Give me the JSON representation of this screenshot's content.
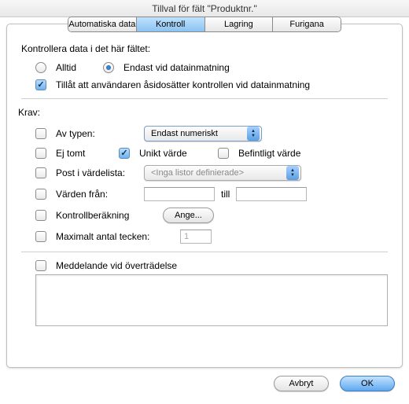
{
  "title": "Tillval för fält \"Produktnr.\"",
  "tabs": {
    "auto": "Automatiska data",
    "kontroll": "Kontroll",
    "lagring": "Lagring",
    "furigana": "Furigana"
  },
  "kontroll": {
    "section_label": "Kontrollera data i det här fältet:",
    "radio_always": "Alltid",
    "radio_dataentry": "Endast vid datainmatning",
    "override": "Tillåt att användaren åsidosätter kontrollen vid datainmatning"
  },
  "krav": {
    "header": "Krav:",
    "type": "Av typen:",
    "type_select": "Endast numeriskt",
    "not_empty": "Ej tomt",
    "unique": "Unikt värde",
    "existing": "Befintligt värde",
    "valuelist": "Post i värdelista:",
    "valuelist_select": "<Inga listor definierade>",
    "range_from": "Värden från:",
    "range_to": "till",
    "calc": "Kontrollberäkning",
    "calc_btn": "Ange...",
    "maxlen": "Maximalt antal tecken:",
    "maxlen_value": "1",
    "message": "Meddelande vid överträdelse"
  },
  "footer": {
    "cancel": "Avbryt",
    "ok": "OK"
  }
}
